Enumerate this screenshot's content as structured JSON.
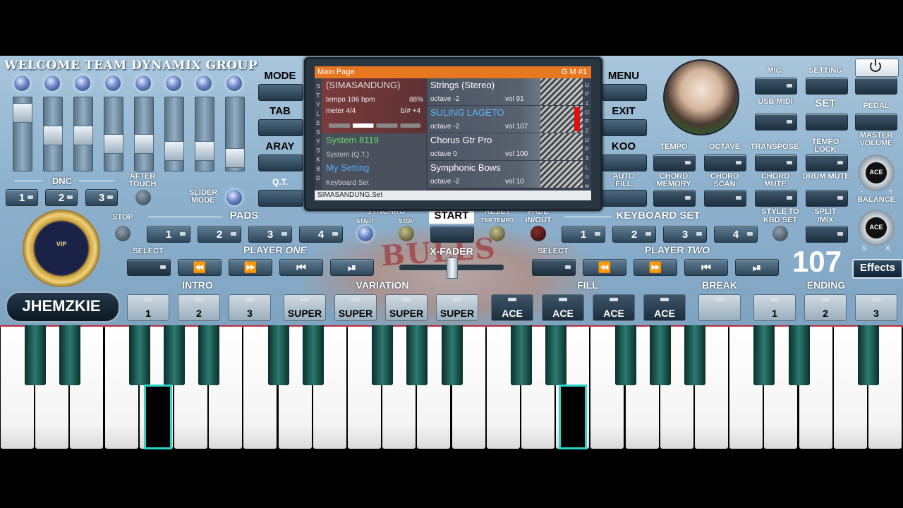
{
  "header_title": "WELCOME TEAM DYNAMIX GROUP",
  "left_side_buttons": [
    "MODE",
    "TAB",
    "ARAY",
    "Q.T."
  ],
  "right_side_buttons": [
    "MENU",
    "EXIT",
    "KOO",
    "AUTO FILL"
  ],
  "dnc": {
    "label": "DNC",
    "buttons": [
      "1",
      "2",
      "3"
    ],
    "after_touch": "AFTER TOUCH",
    "slider_mode": "SLIDER MODE"
  },
  "screen": {
    "title": "Main Page",
    "tag": "G M #1",
    "style_name": "(SIMASANDUNG)",
    "tempo": "tempo 106 bpm",
    "percent": "88%",
    "meter": "meter 4/4",
    "bsharp": "b/# +4",
    "system": "System 8119",
    "system_sub": "System (Q.T.)",
    "mysetting": "My Setting",
    "kbd_sub": "Keyboard Set",
    "footer": "SIMASANDUNG.Set",
    "side_left": [
      "S",
      "T",
      "Y",
      "L",
      "E",
      "S",
      "Y",
      "S",
      "K",
      "B",
      "D"
    ],
    "side_right": [
      "U",
      "P",
      "1",
      "U",
      "P",
      "2",
      "U",
      "P",
      "3",
      "L",
      "o",
      "w"
    ],
    "voices": [
      {
        "name": "Strings (Stereo)",
        "octave": "octave -2",
        "vol": "vol 91"
      },
      {
        "name": "SULING LAGETO",
        "octave": "octave -2",
        "vol": "vol 107"
      },
      {
        "name": "Chorus Gtr Pro",
        "octave": "octave 0",
        "vol": "vol 100"
      },
      {
        "name": "Symphonic Bows",
        "octave": "octave -2",
        "vol": "vol 10"
      }
    ]
  },
  "right_controls": {
    "mic": "MIC.",
    "setting": "SETTING",
    "usb_midi": "USB MIDI",
    "set": "SET",
    "pedal": "PEDAL",
    "tempo": "TEMPO",
    "octave": "OCTAVE",
    "transpose": "TRANSPOSE",
    "tempo_lock": "TEMPO LOCK",
    "chord_memory": "CHORD MEMORY",
    "chord_scan": "CHORD SCAN",
    "chord_mute": "CHORD MUTE",
    "drum_mute": "DRUM MUTE",
    "master_volume": "MASTER VOLUME",
    "balance": "BALANCE",
    "ace": "ACE",
    "s": "S",
    "k": "K",
    "minus": "-",
    "plus": "+",
    "power_icon": "power-icon"
  },
  "pads": {
    "stop": "STOP",
    "label": "PADS",
    "buttons": [
      "1",
      "2",
      "3",
      "4"
    ],
    "synchro": "SYNCHRO",
    "start_small": "START",
    "stop_small": "STOP"
  },
  "start": "START",
  "reset": "RESET",
  "tap_tempo": "TAP TEMPO",
  "fade": "FADE",
  "in_out": "IN/OUT",
  "keyboard_set": {
    "label": "KEYBOARD SET",
    "buttons": [
      "1",
      "2",
      "3",
      "4"
    ],
    "style_to": "STYLE TO",
    "kbd_set": "KBD SET",
    "split": "SPLIT",
    "mix": "/MIX"
  },
  "player_one": {
    "select": "SELECT",
    "label": "PLAYER",
    "label_italic": "ONE"
  },
  "player_two": {
    "select": "SELECT",
    "label": "PLAYER",
    "label_italic": "TWO"
  },
  "xfader": "X-FADER",
  "volume_value": "107",
  "effects": "Effects",
  "brand": "JHEMZKIE",
  "logo_text": "VIP",
  "sections": {
    "intro": "INTRO",
    "variation": "VARIATION",
    "fill": "FILL",
    "break": "BREAK",
    "ending": "ENDING"
  },
  "bottom_buttons": [
    "1",
    "2",
    "3",
    "SUPER",
    "SUPER",
    "SUPER",
    "SUPER",
    "ACE",
    "ACE",
    "ACE",
    "ACE",
    "",
    "1",
    "2",
    "3"
  ]
}
